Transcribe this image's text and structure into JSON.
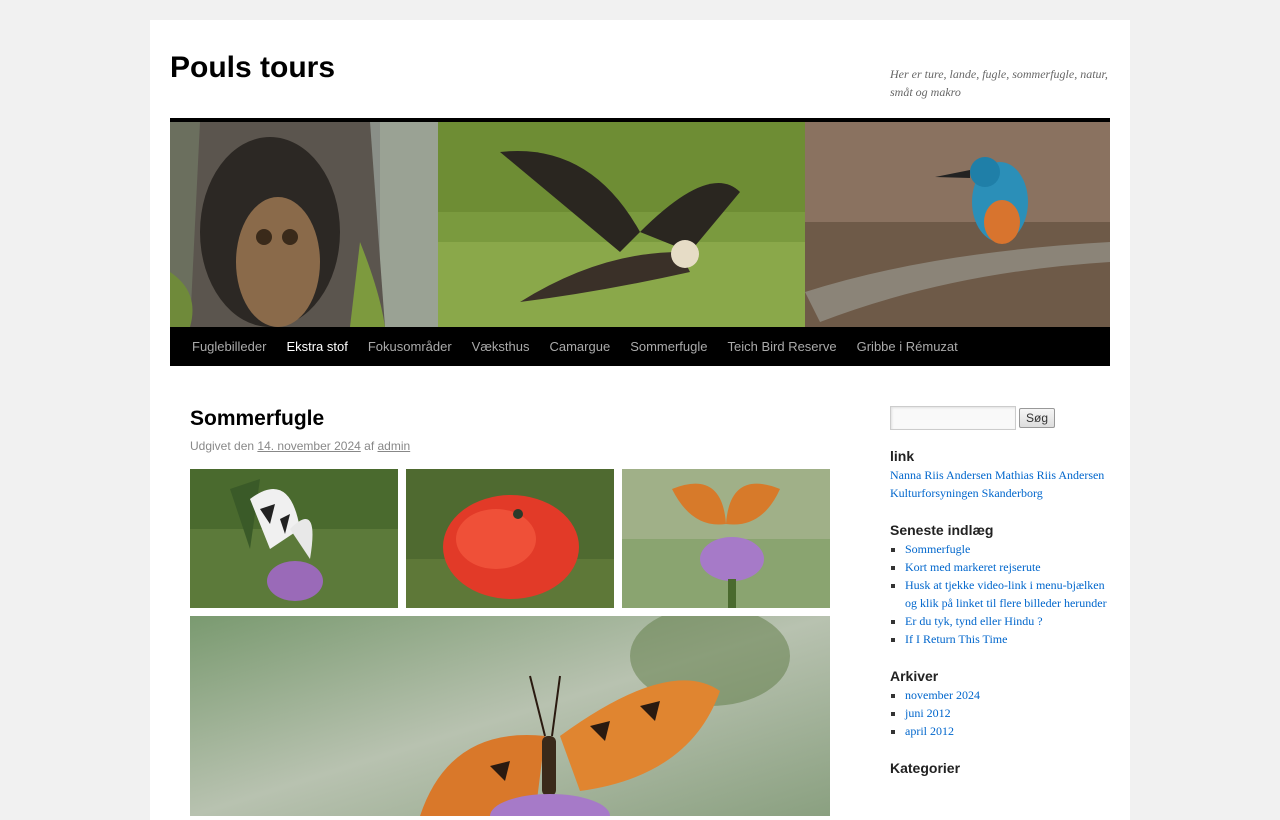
{
  "site": {
    "title": "Pouls tours",
    "description": "Her er ture, lande, fugle, sommerfugle, natur, småt og makro"
  },
  "nav": {
    "items": [
      {
        "label": "Fuglebilleder"
      },
      {
        "label": "Ekstra stof"
      },
      {
        "label": "Fokusområder"
      },
      {
        "label": "Væksthus"
      },
      {
        "label": "Camargue"
      },
      {
        "label": "Sommerfugle"
      },
      {
        "label": "Teich Bird Reserve"
      },
      {
        "label": "Gribbe i Rémuzat"
      }
    ],
    "current_index": 1
  },
  "post": {
    "title": "Sommerfugle",
    "meta_prefix": "Udgivet den",
    "date": "14. november 2024",
    "by": "af",
    "author": "admin"
  },
  "sidebar": {
    "search_button": "Søg",
    "search_value": "",
    "link_widget": {
      "title": "link",
      "links": [
        "Nanna Riis Andersen",
        "Mathias Riis Andersen",
        "Kulturforsyningen Skanderborg"
      ]
    },
    "recent": {
      "title": "Seneste indlæg",
      "items": [
        "Sommerfugle",
        "Kort med markeret rejserute",
        "Husk at tjekke video-link i menu-bjælken og klik på linket til flere billeder herunder",
        "Er du tyk, tynd eller Hindu ?",
        "If I Return This Time"
      ]
    },
    "archives": {
      "title": "Arkiver",
      "items": [
        "november 2024",
        "juni 2012",
        "april 2012"
      ]
    },
    "categories": {
      "title": "Kategorier"
    }
  },
  "colors": {
    "link": "#0066cc",
    "nav_bg": "#000000",
    "nav_text": "#aaaaaa",
    "nav_current": "#ffffff"
  }
}
